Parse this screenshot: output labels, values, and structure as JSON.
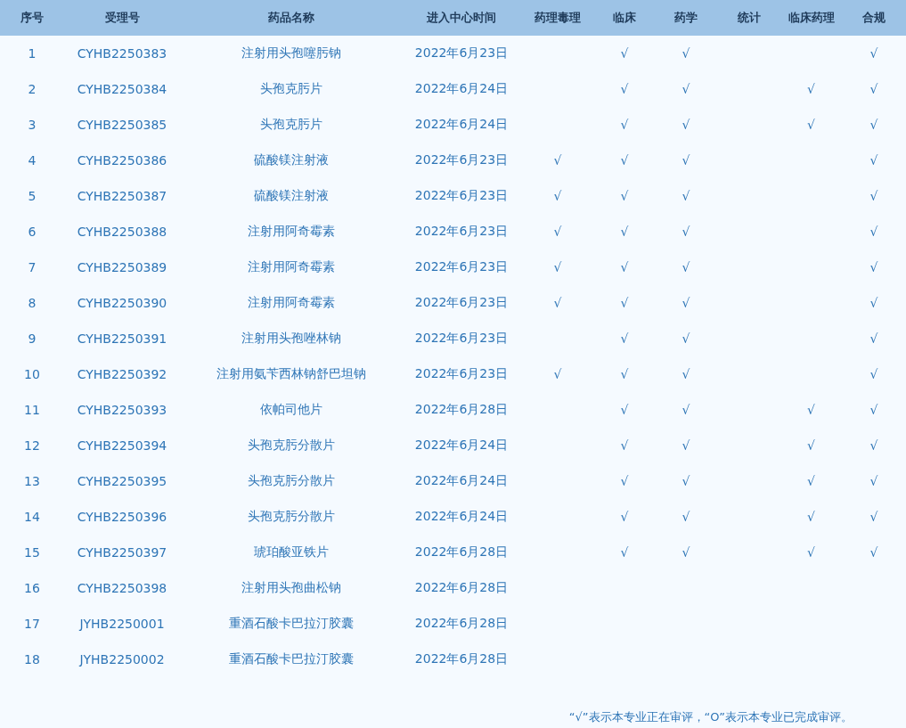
{
  "table": {
    "columns": [
      "序号",
      "受理号",
      "药品名称",
      "进入中心时间",
      "药理毒理",
      "临床",
      "药学",
      "统计",
      "临床药理",
      "合规"
    ],
    "rows": [
      {
        "cells": [
          "1",
          "CYHB2250383",
          "注射用头孢噻肟钠",
          "2022年6月23日",
          null,
          "√",
          "√",
          null,
          null,
          "√"
        ]
      },
      {
        "cells": [
          "2",
          "CYHB2250384",
          "头孢克肟片",
          "2022年6月24日",
          null,
          "√",
          "√",
          null,
          "√",
          "√"
        ]
      },
      {
        "cells": [
          "3",
          "CYHB2250385",
          "头孢克肟片",
          "2022年6月24日",
          null,
          "√",
          "√",
          null,
          "√",
          "√"
        ]
      },
      {
        "cells": [
          "4",
          "CYHB2250386",
          "硫酸镁注射液",
          "2022年6月23日",
          "√",
          "√",
          "√",
          null,
          null,
          "√"
        ]
      },
      {
        "cells": [
          "5",
          "CYHB2250387",
          "硫酸镁注射液",
          "2022年6月23日",
          "√",
          "√",
          "√",
          null,
          null,
          "√"
        ]
      },
      {
        "cells": [
          "6",
          "CYHB2250388",
          "注射用阿奇霉素",
          "2022年6月23日",
          "√",
          "√",
          "√",
          null,
          null,
          "√"
        ]
      },
      {
        "cells": [
          "7",
          "CYHB2250389",
          "注射用阿奇霉素",
          "2022年6月23日",
          "√",
          "√",
          "√",
          null,
          null,
          "√"
        ]
      },
      {
        "cells": [
          "8",
          "CYHB2250390",
          "注射用阿奇霉素",
          "2022年6月23日",
          "√",
          "√",
          "√",
          null,
          null,
          "√"
        ]
      },
      {
        "cells": [
          "9",
          "CYHB2250391",
          "注射用头孢唑林钠",
          "2022年6月23日",
          null,
          "√",
          "√",
          null,
          null,
          "√"
        ]
      },
      {
        "cells": [
          "10",
          "CYHB2250392",
          "注射用氨苄西林钠舒巴坦钠",
          "2022年6月23日",
          "√",
          "√",
          "√",
          null,
          null,
          "√"
        ]
      },
      {
        "cells": [
          "11",
          "CYHB2250393",
          "依帕司他片",
          "2022年6月28日",
          null,
          "√",
          "√",
          null,
          "√",
          "√"
        ]
      },
      {
        "cells": [
          "12",
          "CYHB2250394",
          "头孢克肟分散片",
          "2022年6月24日",
          null,
          "√",
          "√",
          null,
          "√",
          "√"
        ]
      },
      {
        "cells": [
          "13",
          "CYHB2250395",
          "头孢克肟分散片",
          "2022年6月24日",
          null,
          "√",
          "√",
          null,
          "√",
          "√"
        ]
      },
      {
        "cells": [
          "14",
          "CYHB2250396",
          "头孢克肟分散片",
          "2022年6月24日",
          null,
          "√",
          "√",
          null,
          "√",
          "√"
        ]
      },
      {
        "cells": [
          "15",
          "CYHB2250397",
          "琥珀酸亚铁片",
          "2022年6月28日",
          null,
          "√",
          "√",
          null,
          "√",
          "√"
        ]
      },
      {
        "cells": [
          "16",
          "CYHB2250398",
          "注射用头孢曲松钠",
          "2022年6月28日",
          null,
          null,
          null,
          null,
          null,
          null
        ]
      },
      {
        "cells": [
          "17",
          "JYHB2250001",
          "重酒石酸卡巴拉汀胶囊",
          "2022年6月28日",
          null,
          null,
          null,
          null,
          null,
          null
        ]
      },
      {
        "cells": [
          "18",
          "JYHB2250002",
          "重酒石酸卡巴拉汀胶囊",
          "2022年6月28日",
          null,
          null,
          null,
          null,
          null,
          null
        ]
      }
    ]
  },
  "footnote": "“√”表示本专业正在审评，“O”表示本专业已完成审评。"
}
